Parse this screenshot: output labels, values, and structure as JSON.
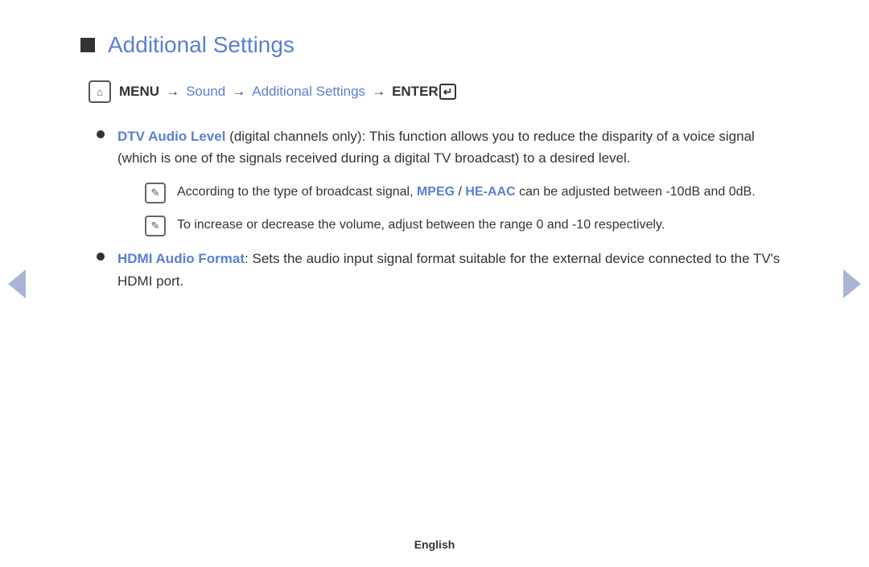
{
  "title": {
    "text": "Additional Settings"
  },
  "menu_path": {
    "menu_label": "MENU",
    "arrow": "→",
    "sound_label": "Sound",
    "additional_settings_label": "Additional Settings",
    "enter_label": "ENTER"
  },
  "bullets": [
    {
      "highlight": "DTV Audio Level",
      "text": " (digital channels only): This function allows you to reduce the disparity of a voice signal (which is one of the signals received during a digital TV broadcast) to a desired level."
    },
    {
      "highlight": "HDMI Audio Format",
      "text": ": Sets the audio input signal format suitable for the external device connected to the TV's HDMI port."
    }
  ],
  "notes": [
    {
      "text": "According to the type of broadcast signal, MPEG / HE-AAC can be adjusted between -10dB and 0dB.",
      "mpeg_highlight": "MPEG",
      "heaac_highlight": "HE-AAC"
    },
    {
      "text": "To increase or decrease the volume, adjust between the range 0 and -10 respectively."
    }
  ],
  "footer": {
    "language": "English"
  },
  "nav": {
    "left_arrow_label": "previous",
    "right_arrow_label": "next"
  }
}
